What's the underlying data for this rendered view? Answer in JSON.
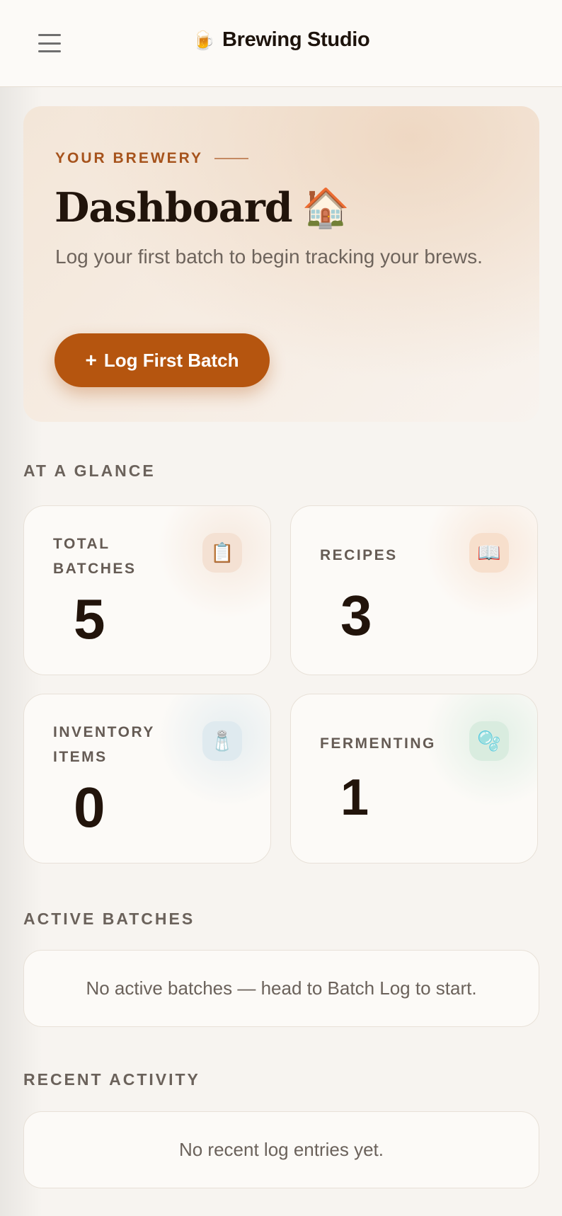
{
  "header": {
    "brand_icon": "🍺",
    "brand_title": "Brewing Studio"
  },
  "hero": {
    "eyebrow": "YOUR BREWERY",
    "title": "Dashboard",
    "title_icon": "🏠",
    "subtitle": "Log your first batch to begin tracking your brews.",
    "cta_icon": "+",
    "cta_label": "Log First Batch"
  },
  "sections": {
    "at_a_glance": "AT A GLANCE",
    "active_batches": "ACTIVE BATCHES",
    "recent_activity": "RECENT ACTIVITY"
  },
  "stats": [
    {
      "label": "TOTAL BATCHES",
      "value": "5",
      "icon": "📋",
      "icon_name": "clipboard-icon",
      "accent": "#f2dccb"
    },
    {
      "label": "RECIPES",
      "value": "3",
      "icon": "📖",
      "icon_name": "book-icon",
      "accent": "#f6dcc8"
    },
    {
      "label": "INVENTORY ITEMS",
      "value": "0",
      "icon": "🧂",
      "icon_name": "jar-icon",
      "accent": "#dde9ee"
    },
    {
      "label": "FERMENTING",
      "value": "1",
      "icon": "🫧",
      "icon_name": "bubbles-icon",
      "accent": "#d8ecdf"
    }
  ],
  "active_batches": {
    "empty_text": "No active batches — head to Batch Log to start."
  },
  "recent_activity": {
    "empty_text": "No recent log entries yet."
  },
  "colors": {
    "brand_accent": "#b5550f",
    "eyebrow": "#a6531c",
    "background": "#f7f4f0"
  }
}
